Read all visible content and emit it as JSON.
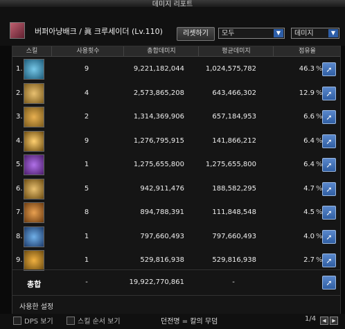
{
  "window": {
    "title": "데미지 리포트"
  },
  "header": {
    "player_info": "버퍼아냥배크 / 眞 크루세이더 (Lv.110)",
    "reset_label": "리셋하기",
    "filter_value": "모두",
    "metric_value": "데미지"
  },
  "table": {
    "columns": [
      "스킬",
      "사용횟수",
      "총합데미지",
      "평균데미지",
      "점유율"
    ],
    "rows": [
      {
        "rank": "1.",
        "icon": "skill-icon-1",
        "uses": "9",
        "total": "9,221,182,044",
        "avg": "1,024,575,782",
        "pct": "46.3",
        "pct_sign": "%"
      },
      {
        "rank": "2.",
        "icon": "skill-icon-2",
        "uses": "4",
        "total": "2,573,865,208",
        "avg": "643,466,302",
        "pct": "12.9",
        "pct_sign": "%"
      },
      {
        "rank": "3.",
        "icon": "skill-icon-3",
        "uses": "2",
        "total": "1,314,369,906",
        "avg": "657,184,953",
        "pct": "6.6",
        "pct_sign": "%"
      },
      {
        "rank": "4.",
        "icon": "skill-icon-4",
        "uses": "9",
        "total": "1,276,795,915",
        "avg": "141,866,212",
        "pct": "6.4",
        "pct_sign": "%"
      },
      {
        "rank": "5.",
        "icon": "skill-icon-5",
        "uses": "1",
        "total": "1,275,655,800",
        "avg": "1,275,655,800",
        "pct": "6.4",
        "pct_sign": "%"
      },
      {
        "rank": "6.",
        "icon": "skill-icon-6",
        "uses": "5",
        "total": "942,911,476",
        "avg": "188,582,295",
        "pct": "4.7",
        "pct_sign": "%"
      },
      {
        "rank": "7.",
        "icon": "skill-icon-7",
        "uses": "8",
        "total": "894,788,391",
        "avg": "111,848,548",
        "pct": "4.5",
        "pct_sign": "%"
      },
      {
        "rank": "8.",
        "icon": "skill-icon-8",
        "uses": "1",
        "total": "797,660,493",
        "avg": "797,660,493",
        "pct": "4.0",
        "pct_sign": "%"
      },
      {
        "rank": "9.",
        "icon": "skill-icon-9",
        "uses": "1",
        "total": "529,816,938",
        "avg": "529,816,938",
        "pct": "2.7",
        "pct_sign": "%"
      }
    ],
    "total": {
      "label": "총합",
      "uses": "-",
      "total": "19,922,770,861",
      "avg": "-"
    }
  },
  "settings": {
    "label": "사용한 설정"
  },
  "footer": {
    "dps_label": "DPS 보기",
    "skill_order_label": "스킬 순서 보기",
    "dungeon": "던전명 = 칼의 무덤",
    "page": "1/4"
  },
  "colors": {
    "accent": "#2f5ea3",
    "background": "#151515"
  }
}
